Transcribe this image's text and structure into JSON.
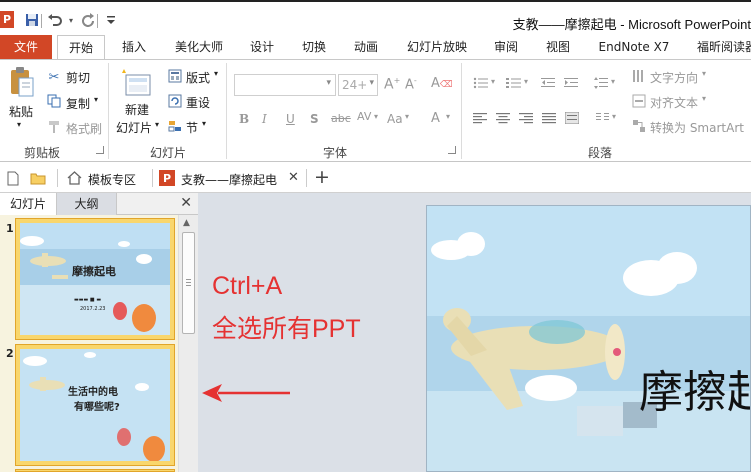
{
  "window": {
    "title": "支教——摩擦起电 - Microsoft PowerPoint",
    "app_icon_letter": "P"
  },
  "ribbon_tabs": [
    "文件",
    "开始",
    "插入",
    "美化大师",
    "设计",
    "切换",
    "动画",
    "幻灯片放映",
    "审阅",
    "视图",
    "EndNote X7",
    "福昕阅读器"
  ],
  "clipboard": {
    "label": "剪贴板",
    "paste": "粘贴",
    "cut": "剪切",
    "copy": "复制",
    "format_painter": "格式刷"
  },
  "slides_group": {
    "label": "幻灯片",
    "new_slide": "新建",
    "new_slide_2": "幻灯片",
    "layout": "版式",
    "reset": "重设",
    "section": "节"
  },
  "font_group": {
    "label": "字体",
    "font_size": "24+",
    "bold": "B",
    "italic": "I",
    "underline": "U",
    "shadow": "S",
    "strike": "abc",
    "spacing": "AV",
    "case": "Aa"
  },
  "paragraph_group": {
    "label": "段落",
    "text_direction": "文字方向",
    "align_text": "对齐文本",
    "convert_smartart": "转换为 SmartArt"
  },
  "doc_tabs": {
    "template_zone": "模板专区",
    "doc_name": "支教——摩擦起电"
  },
  "panel": {
    "tab_slides": "幻灯片",
    "tab_outline": "大纲",
    "close": "✕"
  },
  "thumbnails": [
    {
      "number": "1",
      "title": "摩擦起电",
      "date": "2017.2.23"
    },
    {
      "number": "2",
      "title_line1": "生活中的电",
      "title_line2": "有哪些呢?"
    }
  ],
  "annotation": {
    "line1": "Ctrl+A",
    "line2": "全选所有PPT"
  },
  "main_slide": {
    "title": "摩擦起"
  },
  "colors": {
    "accent": "#d24726",
    "annotation": "#e53232",
    "selection": "#f9d66c"
  }
}
